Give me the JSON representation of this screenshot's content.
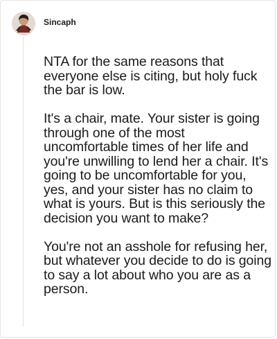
{
  "comment": {
    "author": "Sincaph",
    "paragraphs": [
      "NTA for the same reasons that everyone else is citing, but holy fuck the bar is low.",
      "It's a chair, mate. Your sister is going through one of the most uncomfortable times of her life and you're unwilling to lend her a chair. It's going to be uncomfortable for you, yes, and your sister has no claim to what is yours. But is this seriously the decision you want to make?",
      "You're not an asshole for refusing her, but whatever you decide to do is going to say a lot about who you are as a person."
    ]
  }
}
